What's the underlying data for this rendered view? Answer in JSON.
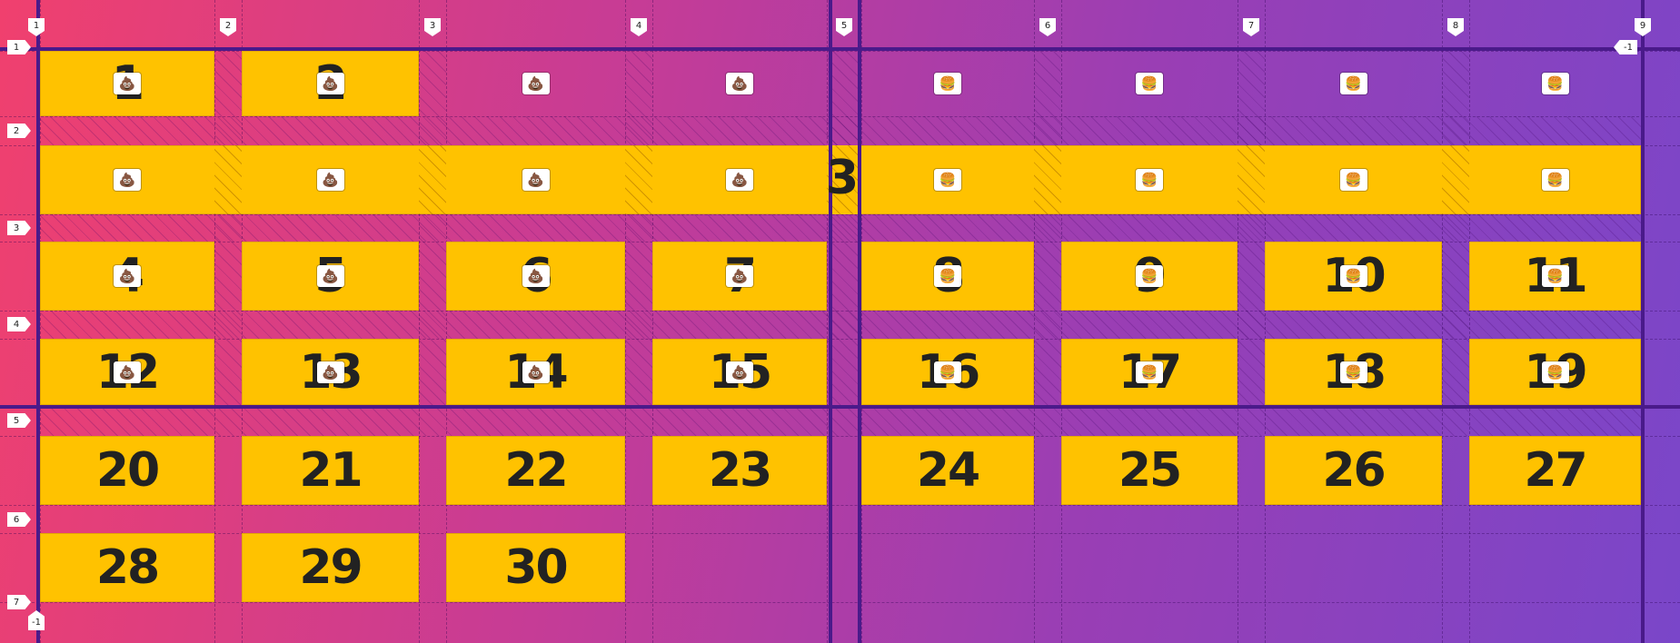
{
  "grid": {
    "col_labels": [
      "1",
      "2",
      "3",
      "4",
      "5",
      "6",
      "7",
      "8",
      "9"
    ],
    "col_end_label": "-1",
    "row_labels": [
      "1",
      "2",
      "3",
      "4",
      "5",
      "6",
      "7"
    ],
    "row_end_label": "-1"
  },
  "spanning_item": {
    "label": "3"
  },
  "items": [
    {
      "label": "1",
      "emoji": "💩"
    },
    {
      "label": "2",
      "emoji": "💩"
    },
    {
      "label": "",
      "emoji": "💩"
    },
    {
      "label": "",
      "emoji": "💩"
    },
    {
      "label": "",
      "emoji": "🍔"
    },
    {
      "label": "",
      "emoji": "🍔"
    },
    {
      "label": "",
      "emoji": "🍔"
    },
    {
      "label": "",
      "emoji": "🍔"
    },
    {
      "label": "",
      "emoji": "💩"
    },
    {
      "label": "",
      "emoji": "💩"
    },
    {
      "label": "",
      "emoji": "💩"
    },
    {
      "label": "",
      "emoji": "💩"
    },
    {
      "label": "",
      "emoji": "🍔"
    },
    {
      "label": "",
      "emoji": "🍔"
    },
    {
      "label": "",
      "emoji": "🍔"
    },
    {
      "label": "",
      "emoji": "🍔"
    },
    {
      "label": "4",
      "emoji": "💩"
    },
    {
      "label": "5",
      "emoji": "💩"
    },
    {
      "label": "6",
      "emoji": "💩"
    },
    {
      "label": "7",
      "emoji": "💩"
    },
    {
      "label": "8",
      "emoji": "🍔"
    },
    {
      "label": "9",
      "emoji": "🍔"
    },
    {
      "label": "10",
      "emoji": "🍔"
    },
    {
      "label": "11",
      "emoji": "🍔"
    },
    {
      "label": "12",
      "emoji": "💩"
    },
    {
      "label": "13",
      "emoji": "💩"
    },
    {
      "label": "14",
      "emoji": "💩"
    },
    {
      "label": "15",
      "emoji": "💩"
    },
    {
      "label": "16",
      "emoji": "🍔"
    },
    {
      "label": "17",
      "emoji": "🍔"
    },
    {
      "label": "18",
      "emoji": "🍔"
    },
    {
      "label": "19",
      "emoji": "🍔"
    },
    {
      "label": "20",
      "emoji": ""
    },
    {
      "label": "21",
      "emoji": ""
    },
    {
      "label": "22",
      "emoji": ""
    },
    {
      "label": "23",
      "emoji": ""
    },
    {
      "label": "24",
      "emoji": ""
    },
    {
      "label": "25",
      "emoji": ""
    },
    {
      "label": "26",
      "emoji": ""
    },
    {
      "label": "27",
      "emoji": ""
    },
    {
      "label": "28",
      "emoji": ""
    },
    {
      "label": "29",
      "emoji": ""
    },
    {
      "label": "30",
      "emoji": ""
    }
  ],
  "colors": {
    "tile": "#ffc200",
    "grid_line": "#4a1a8a",
    "text": "#222222"
  }
}
